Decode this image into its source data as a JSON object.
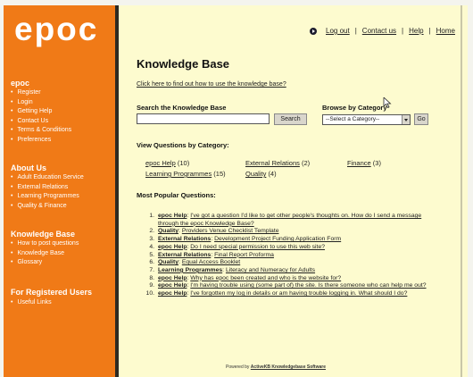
{
  "sidebar": {
    "logo": "epoc",
    "sections": [
      {
        "heading": "epoc",
        "items": [
          "Register",
          "Login",
          "Getting Help",
          "Contact Us",
          "Terms & Conditions",
          "Preferences"
        ]
      },
      {
        "heading": "About Us",
        "items": [
          "Adult Education Service",
          "External Relations",
          "Learning Programmes",
          "Quality & Finance"
        ]
      },
      {
        "heading": "Knowledge Base",
        "items": [
          "How to post questions",
          "Knowledge Base",
          "Glossary"
        ]
      },
      {
        "heading": "For Registered Users",
        "items": [
          "Useful Links"
        ]
      }
    ]
  },
  "topnav": {
    "logout": "Log out",
    "contact": "Contact us",
    "help": "Help",
    "home": "Home",
    "separator": "|"
  },
  "main": {
    "title": "Knowledge Base",
    "help_link": "Click here to find out how to use the knowledge base?",
    "search": {
      "label": "Search the Knowledge Base",
      "value": "",
      "button": "Search"
    },
    "browse": {
      "label": "Browse by Category",
      "selected": "--Select a Category--",
      "go": "Go"
    },
    "categories_heading": "View Questions by Category:",
    "categories": [
      {
        "name": "epoc Help",
        "count": "(10)"
      },
      {
        "name": "External Relations",
        "count": "(2)"
      },
      {
        "name": "Finance",
        "count": "(3)"
      },
      {
        "name": "Learning Programmes",
        "count": "(15)"
      },
      {
        "name": "Quality",
        "count": "(4)"
      }
    ],
    "popular_heading": "Most Popular Questions:",
    "questions": [
      {
        "num": "1.",
        "category": "epoc Help",
        "text": "I've got a question I'd like to get other people's thoughts on. How do I send a message through the epoc Knowledge Base?"
      },
      {
        "num": "2.",
        "category": "Quality",
        "text": "Providers Venue Checklist Template"
      },
      {
        "num": "3.",
        "category": "External Relations",
        "text": "Development Project Funding Application Form"
      },
      {
        "num": "4.",
        "category": "epoc Help",
        "text": "Do I need special permission to use this web site?"
      },
      {
        "num": "5.",
        "category": "External Relations",
        "text": "Final Report Proforma"
      },
      {
        "num": "6.",
        "category": "Quality",
        "text": "Equal Access Booklet"
      },
      {
        "num": "7.",
        "category": "Learning Programmes",
        "text": "Literacy and Numeracy for Adults"
      },
      {
        "num": "8.",
        "category": "epoc Help",
        "text": "Why has epoc been created and who is the website for?"
      },
      {
        "num": "9.",
        "category": "epoc Help",
        "text": "I'm having trouble using (some part of) the site. Is there someone who can help me out?"
      },
      {
        "num": "10.",
        "category": "epoc Help",
        "text": "I've forgotten my log in details or am having trouble logging in. What should I do?"
      }
    ],
    "footer": {
      "prefix": "Powered by",
      "link": "ActiveKB Knowledgebase Software"
    }
  },
  "colors": {
    "sidebar": "#f07a17",
    "page_background": "#fdfbcf",
    "divider": "#2d2a22"
  }
}
